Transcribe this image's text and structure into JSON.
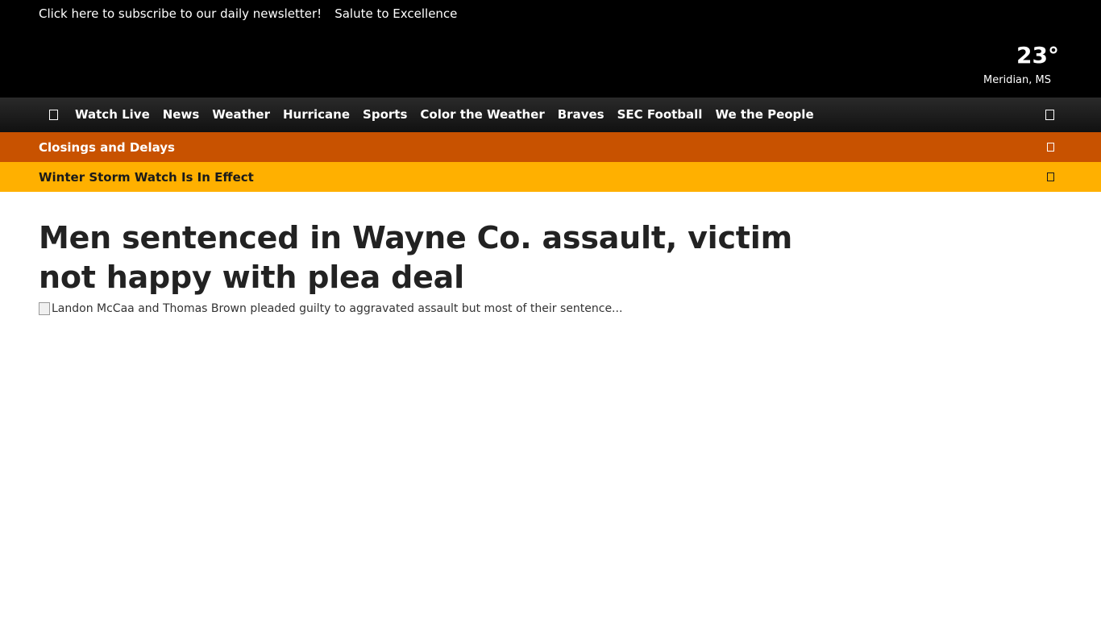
{
  "topbar": {
    "links": [
      "Click here to subscribe to our daily newsletter!",
      "Salute to Excellence"
    ]
  },
  "weather": {
    "temperature": "23°",
    "location": "Meridian, MS"
  },
  "nav": {
    "items": [
      "Watch Live",
      "News",
      "Weather",
      "Hurricane",
      "Sports",
      "Color the Weather",
      "Braves",
      "SEC Football",
      "We the People"
    ]
  },
  "alerts": {
    "closings": "Closings and Delays",
    "storm": "Winter Storm Watch Is In Effect"
  },
  "article": {
    "headline": "Men sentenced in Wayne Co. assault, victim not happy with plea deal",
    "image_alt": "Landon McCaa and Thomas Brown pleaded guilty to aggravated assault but most of their sentence..."
  },
  "colors": {
    "topbar": "#000000",
    "closings_bar": "#c85200",
    "storm_bar": "#ffb000"
  }
}
